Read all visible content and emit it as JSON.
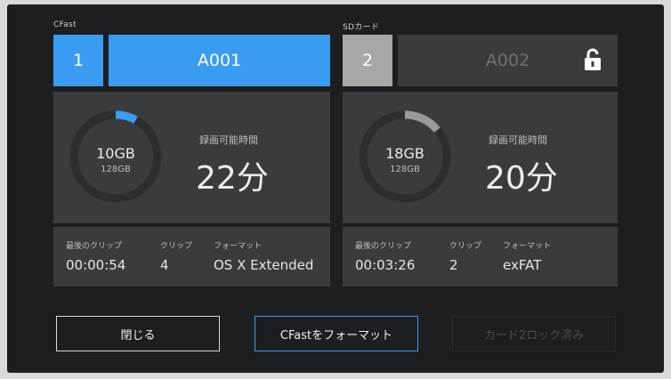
{
  "slots": [
    {
      "type_label": "CFast",
      "number": "1",
      "clip_name": "A001",
      "used": "10GB",
      "total": "128GB",
      "record_time_label": "録画可能時間",
      "record_time": "22分",
      "last_clip_label": "最後のクリップ",
      "last_clip": "00:00:54",
      "clips_label": "クリップ",
      "clips": "4",
      "format_label": "フォーマット",
      "format": "OS X Extended",
      "fill_fraction": 0.08,
      "active": true,
      "locked": false,
      "accent": "#3a9cf0"
    },
    {
      "type_label": "SDカード",
      "number": "2",
      "clip_name": "A002",
      "used": "18GB",
      "total": "128GB",
      "record_time_label": "録画可能時間",
      "record_time": "20分",
      "last_clip_label": "最後のクリップ",
      "last_clip": "00:03:26",
      "clips_label": "クリップ",
      "clips": "2",
      "format_label": "フォーマット",
      "format": "exFAT",
      "fill_fraction": 0.14,
      "active": false,
      "locked": true,
      "accent": "#9a9a9a"
    }
  ],
  "buttons": {
    "close": "閉じる",
    "format_cfast": "CFastをフォーマット",
    "card2_locked": "カード2ロック済み"
  },
  "colors": {
    "accent_blue": "#3a9cf0",
    "panel": "#3a3b3e",
    "background": "#1d1e20"
  }
}
